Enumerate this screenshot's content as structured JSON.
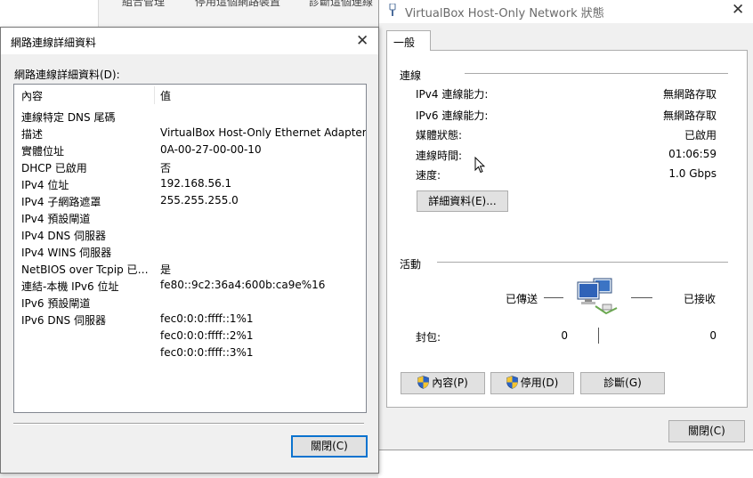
{
  "background_window": {
    "text_1": "組合管理",
    "text_2": "停用這個網路裝置",
    "text_3": "診斷這個連線"
  },
  "status_window": {
    "title": "VirtualBox Host-Only Network 狀態",
    "tab_general": "一般",
    "connection": {
      "group_label": "連線",
      "rows": [
        {
          "label": "IPv4 連線能力:",
          "value": "無網路存取"
        },
        {
          "label": "IPv6 連線能力:",
          "value": "無網路存取"
        },
        {
          "label": "媒體狀態:",
          "value": "已啟用"
        },
        {
          "label": "連線時間:",
          "value": "01:06:59"
        },
        {
          "label": "速度:",
          "value": "1.0 Gbps"
        }
      ],
      "details_button": "詳細資料(E)..."
    },
    "activity": {
      "group_label": "活動",
      "sent_label": "已傳送",
      "received_label": "已接收",
      "packets_label": "封包:",
      "packets_sent": "0",
      "packets_received": "0"
    },
    "buttons": {
      "properties": "內容(P)",
      "disable": "停用(D)",
      "diagnose": "診斷(G)",
      "close": "關閉(C)"
    }
  },
  "details_window": {
    "title": "網路連線詳細資料",
    "list_label": "網路連線詳細資料(D):",
    "columns": {
      "property": "內容",
      "value": "值"
    },
    "rows": [
      {
        "property": "連線特定 DNS 尾碼",
        "value": ""
      },
      {
        "property": "描述",
        "value": "VirtualBox Host-Only Ethernet Adapter"
      },
      {
        "property": "實體位址",
        "value": "0A-00-27-00-00-10"
      },
      {
        "property": "DHCP 已啟用",
        "value": "否"
      },
      {
        "property": "IPv4 位址",
        "value": "192.168.56.1"
      },
      {
        "property": "IPv4 子網路遮罩",
        "value": "255.255.255.0"
      },
      {
        "property": "IPv4 預設閘道",
        "value": ""
      },
      {
        "property": "IPv4 DNS 伺服器",
        "value": ""
      },
      {
        "property": "IPv4 WINS 伺服器",
        "value": ""
      },
      {
        "property": "NetBIOS over Tcpip 已啟...",
        "value": "是"
      },
      {
        "property": "連結-本機 IPv6 位址",
        "value": "fe80::9c2:36a4:600b:ca9e%16"
      },
      {
        "property": "IPv6 預設閘道",
        "value": ""
      },
      {
        "property": "IPv6 DNS 伺服器",
        "value": "fec0:0:0:ffff::1%1"
      },
      {
        "property": "",
        "value": "fec0:0:0:ffff::2%1"
      },
      {
        "property": "",
        "value": "fec0:0:0:ffff::3%1"
      }
    ],
    "close_button": "關閉(C)"
  },
  "colors": {
    "default_button_border": "#0a73cf",
    "button_face": "#e1e1e1",
    "dialog_face": "#f0f0f0",
    "title_text_inactive": "#6a6a6a"
  },
  "icons": {
    "close": "close-icon",
    "network": "network-computers-icon",
    "shield": "uac-shield-icon",
    "cursor": "mouse-cursor-icon",
    "app": "network-adapter-icon"
  }
}
